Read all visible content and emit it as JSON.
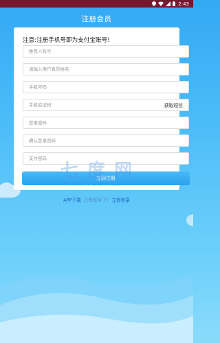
{
  "status_bar": {
    "time": "2:43",
    "icons": [
      "location-icon",
      "wifi-icon",
      "signal-icon",
      "battery-icon"
    ]
  },
  "header": {
    "title": "注册会员"
  },
  "form": {
    "notice": "注意:注册手机号即为支付宝账号!",
    "fields": [
      {
        "placeholder": "推荐人账号",
        "value": ""
      },
      {
        "placeholder": "请输入用户真实姓名",
        "value": ""
      },
      {
        "placeholder": "手机号码",
        "value": ""
      },
      {
        "placeholder": "手机验证码",
        "value": ""
      },
      {
        "placeholder": "登录密码",
        "value": ""
      },
      {
        "placeholder": "确认登录密码",
        "value": ""
      },
      {
        "placeholder": "支付密码",
        "value": ""
      }
    ],
    "sms_button": "获取短信",
    "register_button": "立即注册"
  },
  "links": {
    "app_download": "APP下载",
    "has_account": "已有账号了?",
    "login": "立即登录"
  },
  "colors": {
    "status_bar": "#7a1730",
    "background": "#4bbcf8",
    "button": "#2aa2f0",
    "link": "#1a5fc0"
  }
}
